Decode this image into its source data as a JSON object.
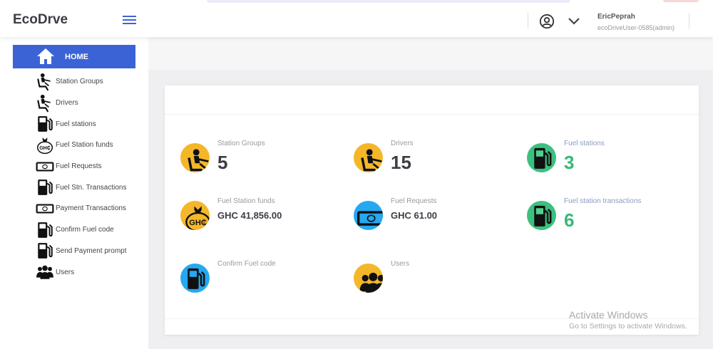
{
  "app": {
    "logo": "EcoDrve"
  },
  "user": {
    "name": "EricPeprah",
    "role": "ecoDriveUser-0585(admin)"
  },
  "sidebar": {
    "home": "HOME",
    "items": [
      {
        "label": "Station Groups",
        "icon": "driver-icon"
      },
      {
        "label": "Drivers",
        "icon": "driver-icon"
      },
      {
        "label": "Fuel stations",
        "icon": "fuel-pump-icon"
      },
      {
        "label": "Fuel Station funds",
        "icon": "money-bag-icon"
      },
      {
        "label": "Fuel Requests",
        "icon": "banknote-icon"
      },
      {
        "label": "Fuel Stn. Transactions",
        "icon": "fuel-pump-icon"
      },
      {
        "label": "Payment Transactions",
        "icon": "banknote-icon"
      },
      {
        "label": "Confirm Fuel code",
        "icon": "fuel-pump-icon"
      },
      {
        "label": "Send Payment prompt",
        "icon": "fuel-pump-icon"
      },
      {
        "label": "Users",
        "icon": "users-icon"
      }
    ]
  },
  "stats": [
    {
      "label": "Station Groups",
      "value": "5",
      "color": "#f4b72a"
    },
    {
      "label": "Drivers",
      "value": "15",
      "color": "#f4b72a"
    },
    {
      "label": "Fuel stations",
      "value": "3",
      "color": "#3cc07f"
    },
    {
      "label": "Fuel Station funds",
      "value": "GHC 41,856.00",
      "color": "#f4b72a"
    },
    {
      "label": "Fuel Requests",
      "value": "GHC 61.00",
      "color": "#25a8f0"
    },
    {
      "label": "Fuel station transactions",
      "value": "6",
      "color": "#3cc07f"
    },
    {
      "label": "Confirm Fuel code",
      "color": "#25a8f0"
    },
    {
      "label": "Users",
      "color": "#f4b72a"
    }
  ],
  "watermark": {
    "title": "Activate Windows",
    "subtitle": "Go to Settings to activate Windows."
  }
}
